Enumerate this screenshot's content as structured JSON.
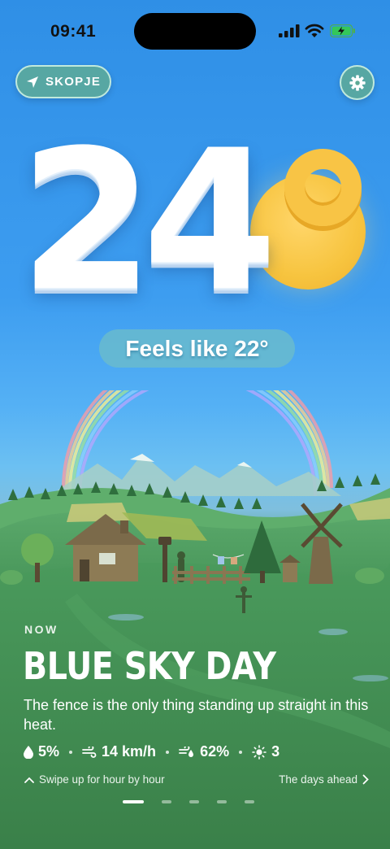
{
  "status_bar": {
    "time": "09:41"
  },
  "location": {
    "label": "SKOPJE"
  },
  "temperature": {
    "value": "24",
    "feels_like": "Feels like 22°"
  },
  "now": {
    "label": "NOW",
    "headline": "BLUE SKY DAY",
    "description": "The fence is the only thing standing up straight in this heat."
  },
  "stats": {
    "precipitation": "5%",
    "wind": "14 km/h",
    "humidity": "62%",
    "uv": "3"
  },
  "footer": {
    "swipe_hint": "Swipe up for hour by hour",
    "days_ahead": "The days ahead"
  },
  "pager": {
    "count": 5,
    "active": 0
  },
  "icons": [
    "location-arrow-icon",
    "gear-icon",
    "raindrop-icon",
    "wind-icon",
    "humidity-icon",
    "sun-icon",
    "chevron-up-icon",
    "chevron-right-icon"
  ],
  "colors": {
    "sun": "#f7c43f",
    "button_bg": "#5eaa96",
    "sky_top": "#2f8fe6",
    "grass": "#3f8a50"
  }
}
